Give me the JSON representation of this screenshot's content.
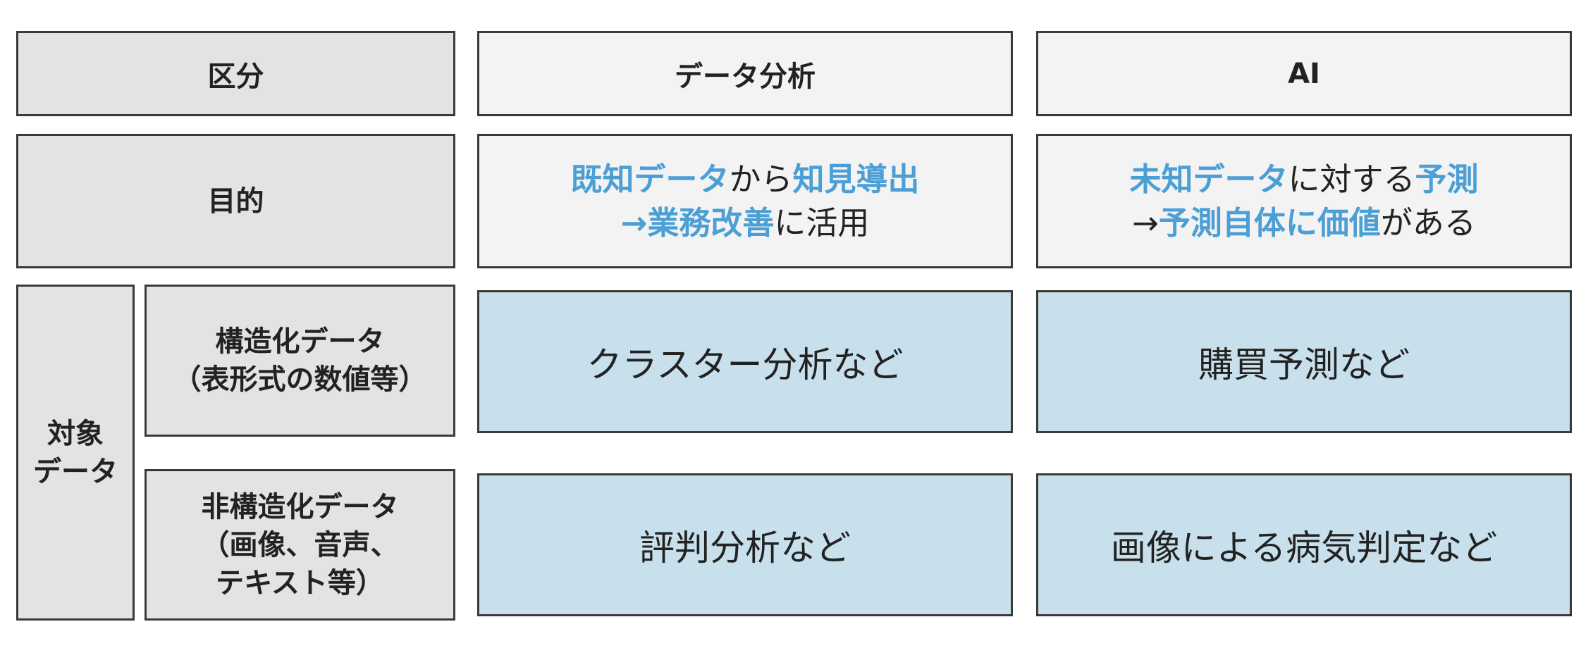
{
  "header": {
    "category": "区分",
    "analysis": "データ分析",
    "ai": "AI"
  },
  "purpose": {
    "label": "目的",
    "analysis": {
      "line1": [
        {
          "text": "既知データ",
          "em": true
        },
        {
          "text": "から",
          "em": false
        },
        {
          "text": "知見導出",
          "em": true
        }
      ],
      "line2": [
        {
          "text": "→",
          "em": false
        },
        {
          "text": "業務改善",
          "em": true
        },
        {
          "text": "に活用",
          "em": false
        }
      ]
    },
    "ai": {
      "line1": [
        {
          "text": "未知データ",
          "em": true
        },
        {
          "text": "に対する",
          "em": false
        },
        {
          "text": "予測",
          "em": true
        }
      ],
      "line2": [
        {
          "text": "→",
          "em": false
        },
        {
          "text": "予測自体に価値",
          "em": true
        },
        {
          "text": "がある",
          "em": false
        }
      ]
    }
  },
  "target": {
    "label_line1": "対象",
    "label_line2": "データ",
    "structured": {
      "label_line1": "構造化データ",
      "label_line2": "（表形式の数値等）",
      "analysis": "クラスター分析など",
      "ai": "購買予測など"
    },
    "unstructured": {
      "label_line1": "非構造化データ",
      "label_line2": "（画像、音声、",
      "label_line3": "テキスト等）",
      "analysis": "評判分析など",
      "ai": "画像による病気判定など"
    }
  },
  "colors": {
    "highlight": "#4b9fd5",
    "header_gray": "#e3e3e3",
    "purpose_bg": "#f3f3f3",
    "example_blue": "#c8e0ec",
    "border": "#3a3a3a"
  }
}
